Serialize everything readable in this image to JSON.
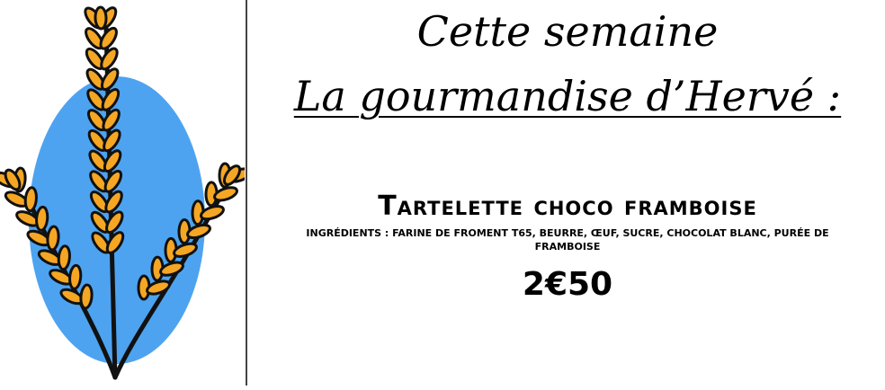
{
  "header": {
    "line1": "Cette semaine",
    "line2": "La gourmandise d’Hervé :"
  },
  "product": {
    "name": "Tartelette choco framboise",
    "ingredients": "Ingrédients : farine de froment T65, beurre, œuf, sucre, chocolat blanc, purée de framboise",
    "price": "2€50"
  },
  "logo": {
    "icon": "wheat-icon",
    "background_color": "#4da3f0",
    "grain_color": "#f5a623",
    "outline_color": "#111111"
  }
}
